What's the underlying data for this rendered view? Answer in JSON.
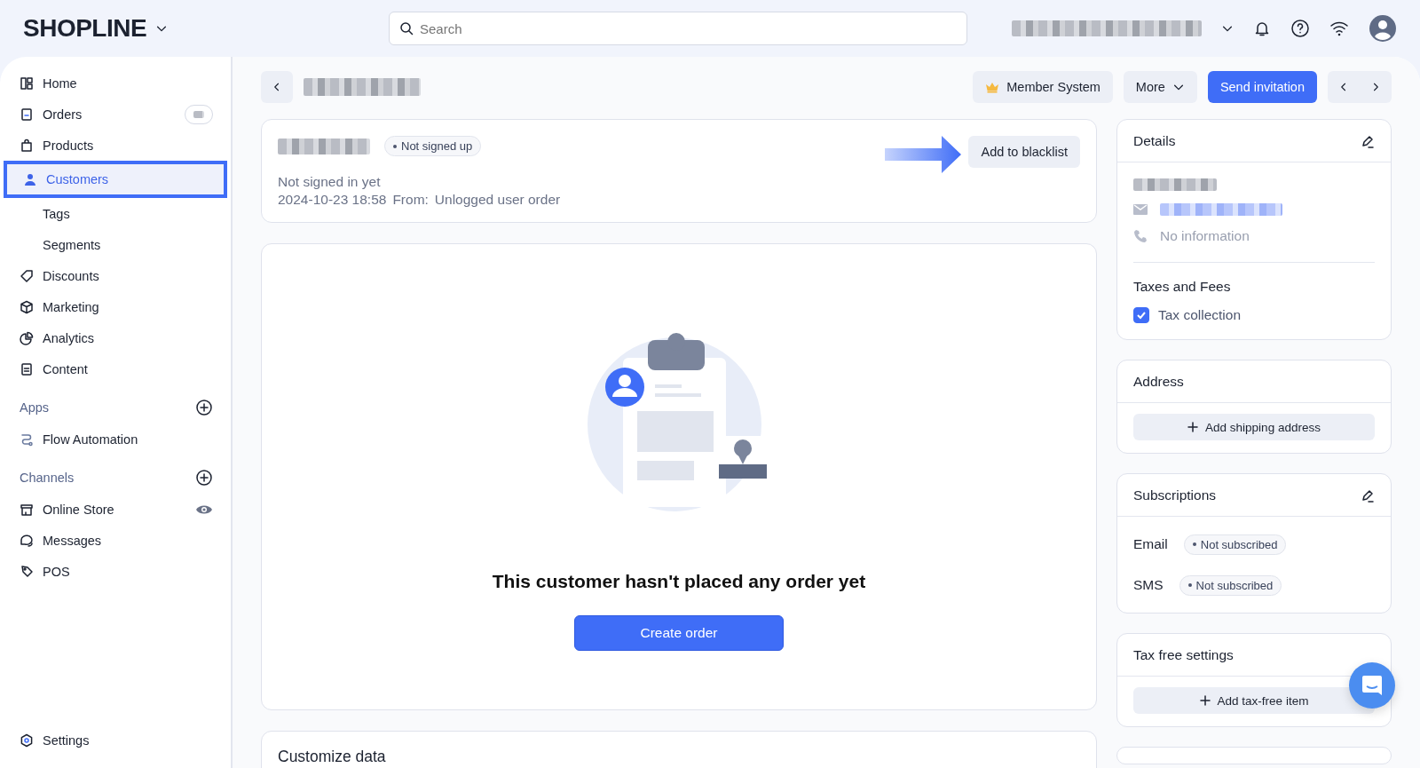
{
  "header": {
    "logo": "SHOPLINE",
    "search": {
      "placeholder": "Search"
    }
  },
  "sidebar": {
    "items": [
      {
        "kind": "nav",
        "label": "Home",
        "selected": false,
        "badge": false
      },
      {
        "kind": "nav",
        "label": "Orders",
        "selected": false,
        "badge": true
      },
      {
        "kind": "nav",
        "label": "Products",
        "selected": false,
        "badge": false
      },
      {
        "kind": "nav",
        "label": "Customers",
        "selected": true,
        "badge": false
      },
      {
        "kind": "sub",
        "label": "Tags",
        "selected": false
      },
      {
        "kind": "sub",
        "label": "Segments",
        "selected": false
      },
      {
        "kind": "nav",
        "label": "Discounts",
        "selected": false,
        "badge": false
      },
      {
        "kind": "nav",
        "label": "Marketing",
        "selected": false,
        "badge": false
      },
      {
        "kind": "nav",
        "label": "Analytics",
        "selected": false,
        "badge": false
      },
      {
        "kind": "nav",
        "label": "Content",
        "selected": false,
        "badge": false
      },
      {
        "kind": "section",
        "label": "Apps"
      },
      {
        "kind": "nav",
        "label": "Flow Automation",
        "selected": false,
        "badge": false
      },
      {
        "kind": "section",
        "label": "Channels"
      },
      {
        "kind": "nav",
        "label": "Online Store",
        "selected": false,
        "badge": false,
        "eye": true
      },
      {
        "kind": "nav",
        "label": "Messages",
        "selected": false,
        "badge": false
      },
      {
        "kind": "nav",
        "label": "POS",
        "selected": false,
        "badge": false
      }
    ],
    "footer": {
      "label": "Settings"
    }
  },
  "toolbar": {
    "actions": [
      {
        "kind": "crown",
        "label": "Member System"
      },
      {
        "kind": "menu",
        "label": "More"
      },
      {
        "kind": "primary",
        "label": "Send invitation"
      }
    ]
  },
  "customer": {
    "status": "Not signed up",
    "signin": "Not signed in yet",
    "date": "2024-10-23 18:58",
    "from_label": "From:",
    "from": "Unlogged user order",
    "blacklist": "Add to blacklist"
  },
  "orders": {
    "message": "This customer hasn't placed any order yet",
    "button": "Create order"
  },
  "customize": {
    "title": "Customize data"
  },
  "details": {
    "title": "Details",
    "phone": "No information",
    "taxes_title": "Taxes and Fees",
    "tax": {
      "label": "Tax collection",
      "checked": true
    }
  },
  "address": {
    "title": "Address",
    "button": "Add shipping address"
  },
  "subscriptions": {
    "title": "Subscriptions",
    "rows": [
      {
        "label": "Email",
        "status": "Not subscribed"
      },
      {
        "label": "SMS",
        "status": "Not subscribed"
      }
    ]
  },
  "tax_free": {
    "title": "Tax free settings",
    "button": "Add tax-free item"
  }
}
